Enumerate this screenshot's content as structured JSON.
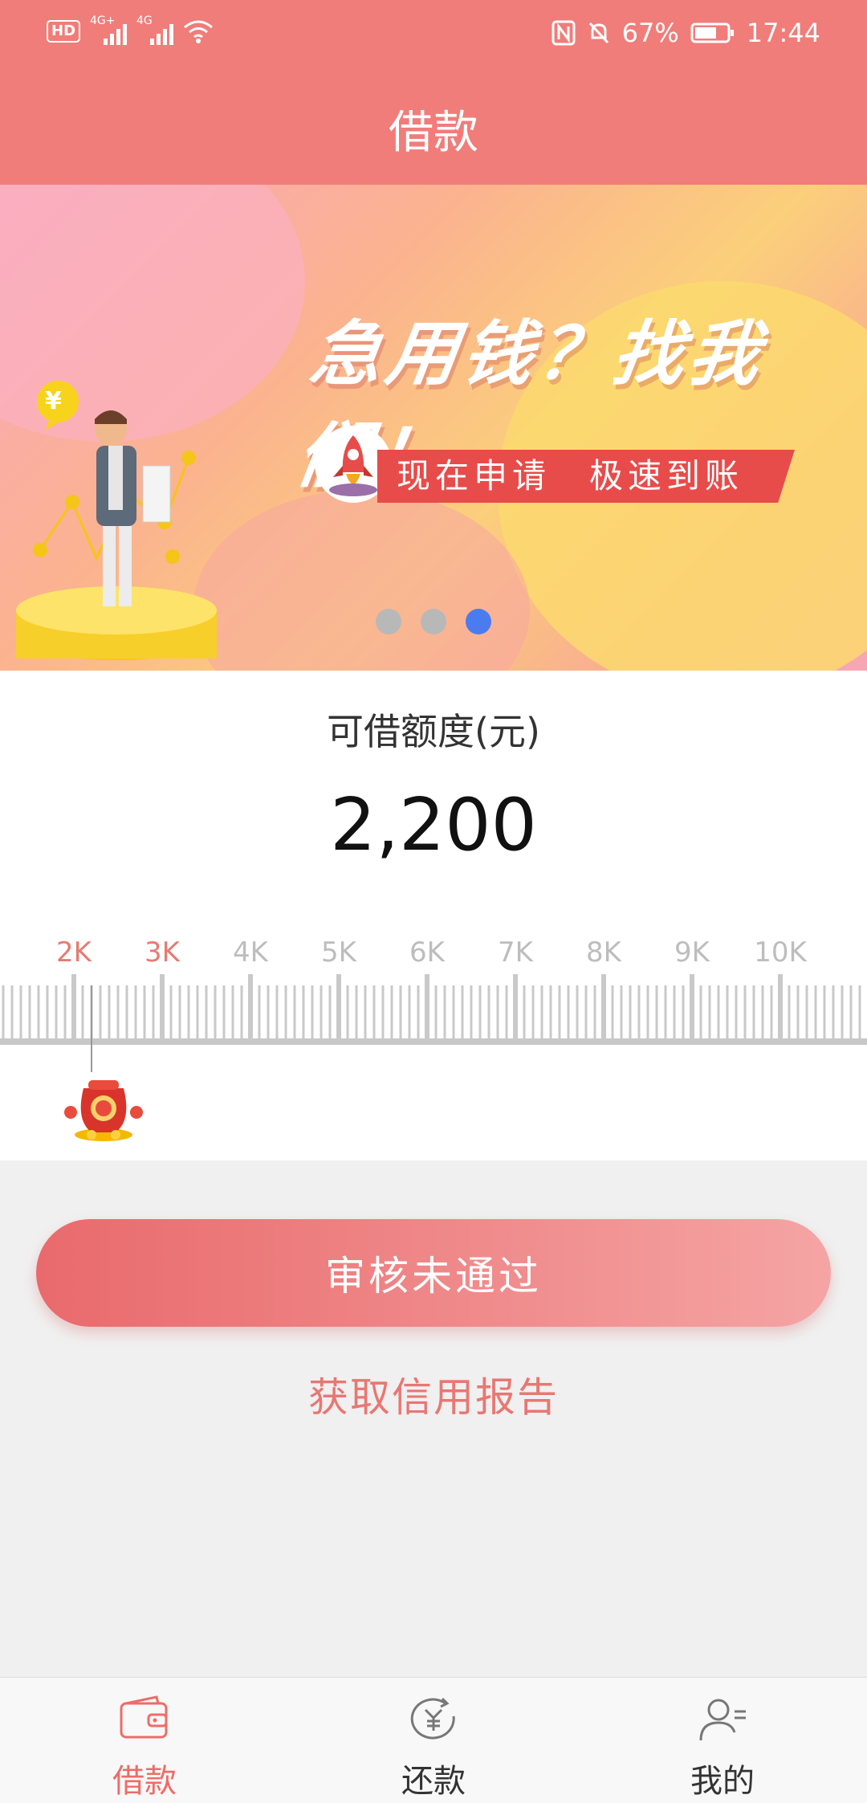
{
  "status_bar": {
    "left_badge": "HD",
    "sim1_label": "4G+",
    "sim2_label": "4G",
    "battery": "67%",
    "time": "17:44"
  },
  "header": {
    "title": "借款"
  },
  "banner": {
    "headline": "急用钱？找我们！",
    "ribbon": "现在申请　极速到账",
    "coin_symbol": "¥",
    "active_slide": 3,
    "slide_count": 3
  },
  "credit": {
    "label": "可借额度(元)",
    "amount": "2,200",
    "ruler_ticks": [
      "2K",
      "3K",
      "4K",
      "5K",
      "6K",
      "7K",
      "8K",
      "9K",
      "10K"
    ],
    "highlighted_ticks": [
      "2K",
      "3K"
    ],
    "selected_value": 2200
  },
  "actions": {
    "primary_button": "审核未通过",
    "secondary_link": "获取信用报告"
  },
  "tabbar": {
    "items": [
      {
        "label": "借款",
        "icon": "wallet-icon",
        "active": true
      },
      {
        "label": "还款",
        "icon": "repay-icon",
        "active": false
      },
      {
        "label": "我的",
        "icon": "profile-icon",
        "active": false
      }
    ]
  },
  "colors": {
    "header_bg": "#f07d7a",
    "accent": "#ee6c67",
    "dot_active": "#4a7cf0",
    "tick_highlight": "#e57b73",
    "tick_normal": "#bdbdbd"
  }
}
